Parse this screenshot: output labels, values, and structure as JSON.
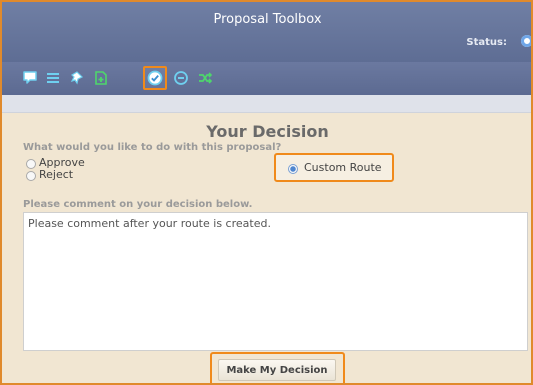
{
  "window": {
    "title": "Proposal Toolbox",
    "status_label": "Status:"
  },
  "toolbar": {
    "tools": [
      {
        "name": "comment-tool",
        "icon": "comment-icon",
        "active": false
      },
      {
        "name": "list-tool",
        "icon": "list-icon",
        "active": false
      },
      {
        "name": "pin-tool",
        "icon": "pin-icon",
        "active": false
      },
      {
        "name": "add-document-tool",
        "icon": "add-document-icon",
        "active": false
      },
      {
        "name": "decision-tool",
        "icon": "checkmark-icon",
        "active": true
      },
      {
        "name": "minus-tool",
        "icon": "minus-circle-icon",
        "active": false
      },
      {
        "name": "route-tool",
        "icon": "shuffle-icon",
        "active": false
      }
    ]
  },
  "decision": {
    "heading": "Your Decision",
    "question": "What would you like to do with this proposal?",
    "options": {
      "approve": "Approve",
      "reject": "Reject",
      "custom_route": "Custom Route"
    },
    "selected": "custom_route",
    "comment_label": "Please comment on your decision below.",
    "comment_text": "Please comment after your route is created.",
    "submit_label": "Make My Decision"
  },
  "colors": {
    "header": "#6676a0",
    "highlight": "#f08a1b",
    "panel_bg": "#f1e6d2",
    "icon_blue": "#6fd0f0",
    "icon_green": "#4ed66c"
  }
}
